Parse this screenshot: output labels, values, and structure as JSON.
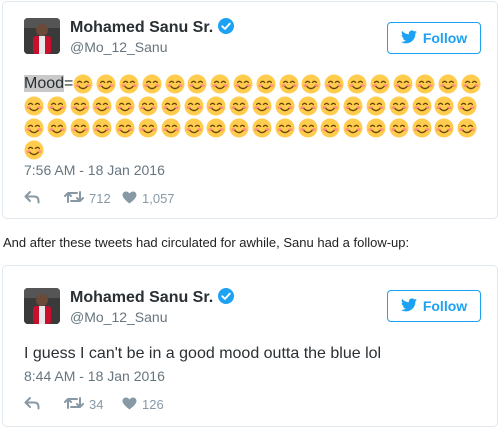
{
  "colors": {
    "follow_accent": "#1da1f2",
    "verified_badge": "#1da1f2",
    "muted_text": "#66757f",
    "action_icons": "#8899a6",
    "emoji_face": "#ffcc4d",
    "emoji_cheeks": "#ff7892"
  },
  "tweets": [
    {
      "author_name": "Mohamed Sanu Sr.",
      "handle": "@Mo_12_Sanu",
      "verified": true,
      "follow_label": "Follow",
      "text_prefix": "Mood",
      "text_separator": "=",
      "emoji": "smiling-face-with-smiling-eyes",
      "emoji_count": 59,
      "timestamp": "7:56 AM - 18 Jan 2016",
      "retweets": "712",
      "likes": "1,057"
    },
    {
      "author_name": "Mohamed Sanu Sr.",
      "handle": "@Mo_12_Sanu",
      "verified": true,
      "follow_label": "Follow",
      "text": "I guess I can't be in a good mood outta the blue lol",
      "timestamp": "8:44 AM - 18 Jan 2016",
      "retweets": "34",
      "likes": "126"
    }
  ],
  "between_text": "And after these tweets had circulated for awhile, Sanu had a follow-up:"
}
